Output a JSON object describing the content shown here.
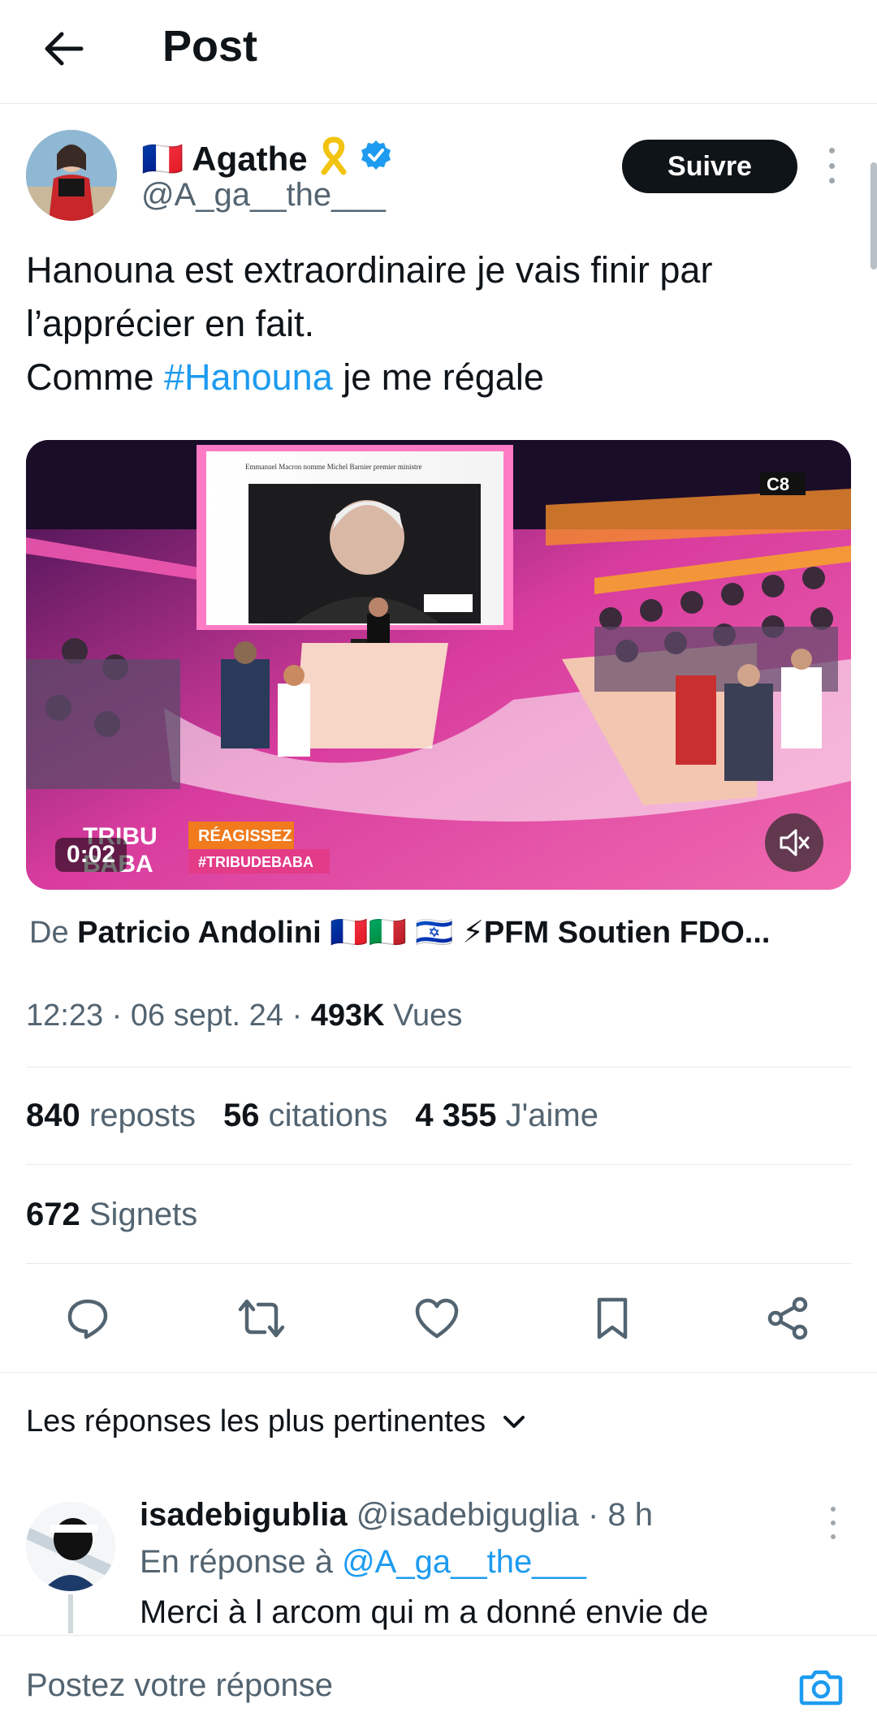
{
  "header": {
    "title": "Post"
  },
  "post": {
    "author": {
      "flag": "🇫🇷",
      "name": "Agathe",
      "handle": "@A_ga__the___"
    },
    "follow_label": "Suivre",
    "text": {
      "line1": "Hanouna est extraordinaire je vais finir par",
      "line2": "l’apprécier en fait.",
      "line3_prefix": "Comme ",
      "hashtag": "#Hanouna",
      "line3_suffix": " je me régale"
    },
    "video": {
      "timecode": "0:02",
      "channel_logo": "C8",
      "headline": "Emmanuel Macron nomme Michel Barnier premier ministre",
      "banner_top": "RÉAGISSEZ",
      "banner_bottom": "#TRIBUDEBABA",
      "show_logo_top": "TRIBU",
      "show_logo_bottom": "BABA",
      "muted": true
    },
    "source_prefix": "De ",
    "source_name": "Patricio Andolini 🇫🇷🇮🇹 🇮🇱 ⚡PFM Soutien FDO...",
    "time": "12:23",
    "date": "06 sept. 24",
    "views_count": "493K",
    "views_label": "Vues",
    "stats": {
      "reposts_count": "840",
      "reposts_label": "reposts",
      "quotes_count": "56",
      "quotes_label": "citations",
      "likes_count": "4 355",
      "likes_label": "J'aime"
    },
    "bookmarks_count": "672",
    "bookmarks_label": "Signets"
  },
  "actions": [
    "reply-icon",
    "repost-icon",
    "like-icon",
    "bookmark-icon",
    "share-icon"
  ],
  "replies_sort": {
    "label": "Les réponses les plus pertinentes"
  },
  "reply": {
    "name": "isadebigublia",
    "handle": "@isadebiguglia",
    "age": "8 h",
    "replying_prefix": "En réponse à ",
    "replying_to": "@A_ga__the___",
    "text": "Merci à l arcom qui m a donné envie de"
  },
  "composer": {
    "placeholder": "Postez votre réponse"
  },
  "colors": {
    "accent": "#1d9bf0",
    "text": "#0f1419",
    "muted": "#536471",
    "verified": "#1d9bf0"
  }
}
